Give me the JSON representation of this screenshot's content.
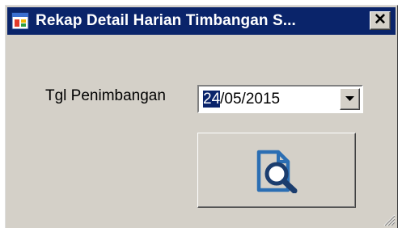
{
  "window": {
    "title": "Rekap Detail Harian Timbangan S...",
    "close_label": "✕"
  },
  "form": {
    "date_label": "Tgl Penimbangan",
    "date_day": "24",
    "date_rest": "/05/2015"
  },
  "icons": {
    "app": "app-icon",
    "close": "close-icon",
    "dropdown": "chevron-down-icon",
    "search": "document-search-icon",
    "grip": "resize-grip-icon"
  },
  "colors": {
    "titlebar": "#0a246a",
    "face": "#d4d0c8",
    "icon_accent": "#2b6eb3"
  }
}
